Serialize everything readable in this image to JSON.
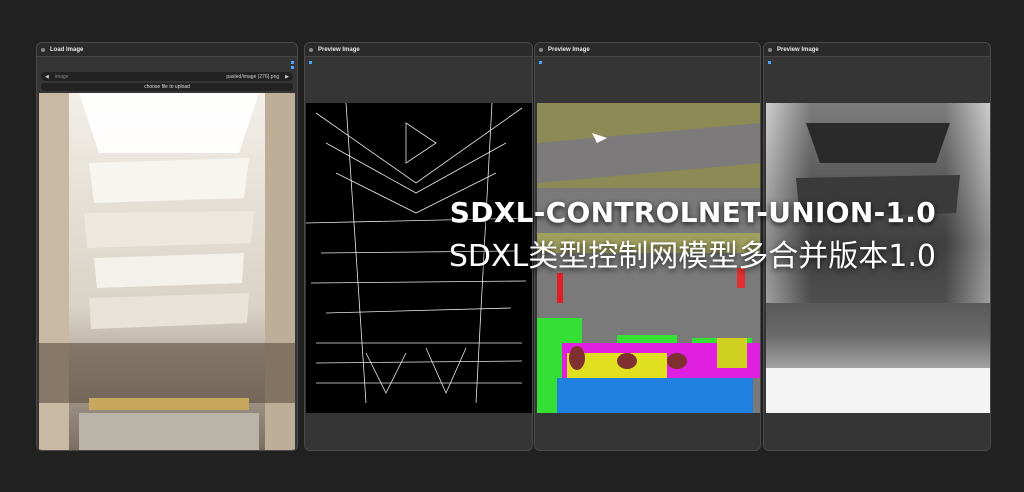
{
  "nodes": [
    {
      "id": "#12",
      "title": "Load Image",
      "image_label": "image",
      "image_value": "pasted/image (276).png",
      "upload_label": "choose file to upload"
    },
    {
      "id": "#14",
      "title": "Preview Image"
    },
    {
      "id": "#15",
      "title": "Preview Image"
    },
    {
      "id": "#19",
      "title": "Preview Image"
    }
  ],
  "overlay": {
    "title_line1": "SDXL-CONTROLNET-UNION-1.0",
    "title_line2": "SDXL类型控制网模型多合并版本1.0"
  },
  "colors": {
    "canvas_bg": "#212121",
    "node_bg": "#353535",
    "accent_blue": "#4aa3ff"
  }
}
